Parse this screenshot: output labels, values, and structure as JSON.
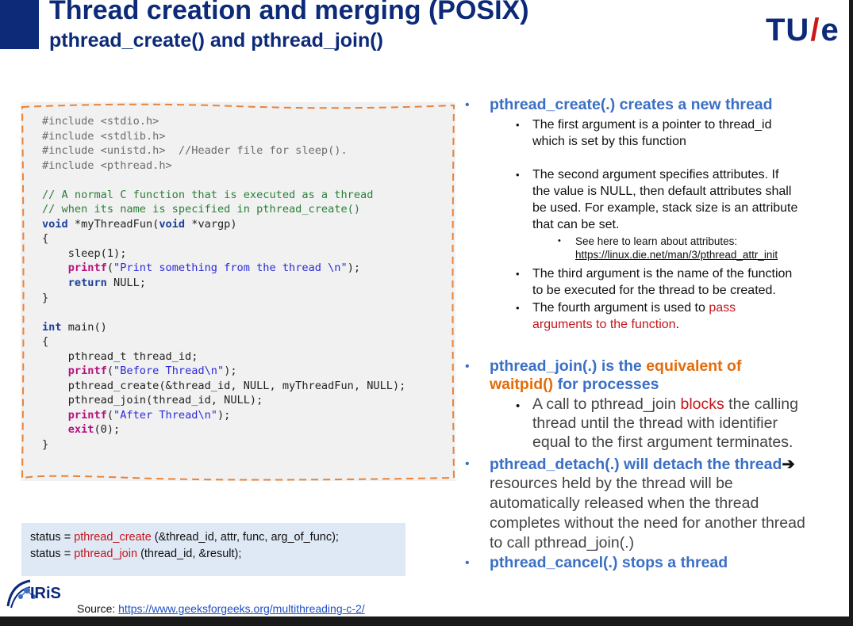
{
  "title": "Thread creation and merging (POSIX)",
  "subtitle": "pthread_create() and pthread_join()",
  "logo": {
    "text_tu": "TU",
    "text_e": "e"
  },
  "code_lines": [
    {
      "cls": "c-pre",
      "text": "#include <stdio.h>"
    },
    {
      "cls": "c-pre",
      "text": "#include <stdlib.h>"
    },
    {
      "cls": "c-pre",
      "text": "#include <unistd.h>  //Header file for sleep()."
    },
    {
      "cls": "c-pre",
      "text": "#include <pthread.h>"
    },
    {
      "cls": "",
      "text": ""
    },
    {
      "cls": "c-cmt",
      "text": "// A normal C function that is executed as a thread"
    },
    {
      "cls": "c-cmt",
      "text": "// when its name is specified in pthread_create()"
    },
    {
      "cls": "",
      "parts": [
        {
          "c": "c-kw",
          "t": "void"
        },
        {
          "c": "",
          "t": " *myThreadFun("
        },
        {
          "c": "c-kw",
          "t": "void"
        },
        {
          "c": "",
          "t": " *vargp)"
        }
      ]
    },
    {
      "cls": "",
      "text": "{"
    },
    {
      "cls": "",
      "text": "    sleep(1);"
    },
    {
      "cls": "",
      "parts": [
        {
          "c": "",
          "t": "    "
        },
        {
          "c": "c-fn",
          "t": "printf"
        },
        {
          "c": "",
          "t": "("
        },
        {
          "c": "c-str",
          "t": "\"Print something from the thread \\n\""
        },
        {
          "c": "",
          "t": ");"
        }
      ]
    },
    {
      "cls": "",
      "parts": [
        {
          "c": "",
          "t": "    "
        },
        {
          "c": "c-kw",
          "t": "return"
        },
        {
          "c": "",
          "t": " NULL;"
        }
      ]
    },
    {
      "cls": "",
      "text": "}"
    },
    {
      "cls": "",
      "text": ""
    },
    {
      "cls": "",
      "parts": [
        {
          "c": "c-kw",
          "t": "int"
        },
        {
          "c": "",
          "t": " main()"
        }
      ]
    },
    {
      "cls": "",
      "text": "{"
    },
    {
      "cls": "",
      "text": "    pthread_t thread_id;"
    },
    {
      "cls": "",
      "parts": [
        {
          "c": "",
          "t": "    "
        },
        {
          "c": "c-fn",
          "t": "printf"
        },
        {
          "c": "",
          "t": "("
        },
        {
          "c": "c-str",
          "t": "\"Before Thread\\n\""
        },
        {
          "c": "",
          "t": ");"
        }
      ]
    },
    {
      "cls": "",
      "text": "    pthread_create(&thread_id, NULL, myThreadFun, NULL);"
    },
    {
      "cls": "",
      "text": "    pthread_join(thread_id, NULL);"
    },
    {
      "cls": "",
      "parts": [
        {
          "c": "",
          "t": "    "
        },
        {
          "c": "c-fn",
          "t": "printf"
        },
        {
          "c": "",
          "t": "("
        },
        {
          "c": "c-str",
          "t": "\"After Thread\\n\""
        },
        {
          "c": "",
          "t": ");"
        }
      ]
    },
    {
      "cls": "",
      "parts": [
        {
          "c": "",
          "t": "    "
        },
        {
          "c": "c-fn",
          "t": "exit"
        },
        {
          "c": "",
          "t": "(0);"
        }
      ]
    },
    {
      "cls": "",
      "text": "}"
    }
  ],
  "signatures": {
    "line1": {
      "pre": "status = ",
      "fn": "pthread_create",
      "post": " (&thread_id, attr, func, arg_of_func);"
    },
    "line2": {
      "pre": "status = ",
      "fn": "pthread_join",
      "post": " (thread_id, &result);"
    }
  },
  "iris_label": "IRiS",
  "source": {
    "label": "Source: ",
    "url": "https://www.geeksforgeeks.org/multithreading-c-2/"
  },
  "bullets": {
    "b1_head": "pthread_create(.) creates a new thread",
    "b1_s1_l1": "The first argument is a pointer to thread_id",
    "b1_s1_l2": "which is set by this function",
    "b1_s2_l1": "The second argument specifies attributes. If",
    "b1_s2_l2": "the value is NULL, then default attributes shall",
    "b1_s2_l3": "be used. For example, stack size is an attribute",
    "b1_s2_l4": "that can be set.",
    "b1_s2_sub_l1": "See here to learn about attributes:",
    "b1_s2_sub_link": "https://linux.die.net/man/3/pthread_attr_init",
    "b1_s3_l1": "The third argument is the name of the function",
    "b1_s3_l2": "to be executed for the thread to be created.",
    "b1_s4_pre": "The fourth argument is used to ",
    "b1_s4_red1": "pass",
    "b1_s4_red2": "arguments to the function",
    "b1_s4_post": ".",
    "b2_head_pre": "pthread_join(.) is the ",
    "b2_head_orange1": "equivalent of",
    "b2_head_orange2": "waitpid()",
    "b2_head_post": " for processes",
    "b2_s1_pre": "A call to pthread_join ",
    "b2_s1_red": "blocks",
    "b2_s1_post": " the calling",
    "b2_s1_l2": "thread until the thread with identifier",
    "b2_s1_l3": "equal to the first argument terminates.",
    "b3_head": "pthread_detach(.) will detach the thread",
    "b3_arrow": "➔",
    "b3_l2": "resources held by the thread will be",
    "b3_l3": "automatically released when the thread",
    "b3_l4": "completes without the need for another thread",
    "b3_l5": "to call pthread_join(.)",
    "b4_head": "pthread_cancel(.) stops a thread"
  }
}
